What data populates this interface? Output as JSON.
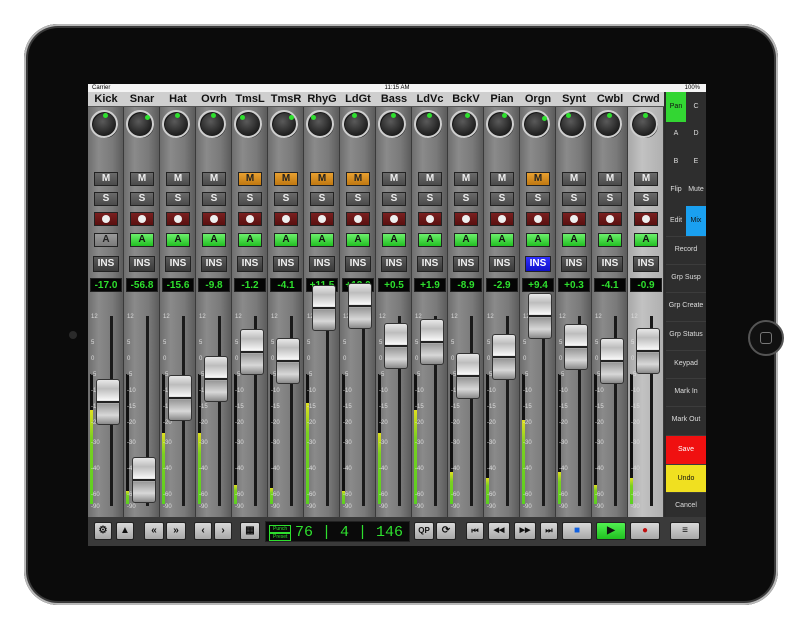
{
  "status_bar": {
    "carrier": "Carrier",
    "time": "11:15 AM",
    "battery": "100%"
  },
  "channels": [
    {
      "name": "Kick",
      "mute": "M",
      "mute_on": false,
      "solo": "S",
      "auto": "A",
      "auto_on": false,
      "ins": "INS",
      "ins_on": false,
      "level": "-17.0",
      "fader_db": -17.0,
      "meter": 0.72,
      "knob_angle": 0
    },
    {
      "name": "Snar",
      "mute": "M",
      "mute_on": false,
      "solo": "S",
      "auto": "A",
      "auto_on": true,
      "ins": "INS",
      "ins_on": false,
      "level": "-56.8",
      "fader_db": -56.8,
      "meter": 0.1,
      "knob_angle": 40
    },
    {
      "name": "Hat",
      "mute": "M",
      "mute_on": false,
      "solo": "S",
      "auto": "A",
      "auto_on": true,
      "ins": "INS",
      "ins_on": false,
      "level": "-15.6",
      "fader_db": -15.6,
      "meter": 0.55,
      "knob_angle": 0
    },
    {
      "name": "Ovrh",
      "mute": "M",
      "mute_on": false,
      "solo": "S",
      "auto": "A",
      "auto_on": true,
      "ins": "INS",
      "ins_on": false,
      "level": "-9.8",
      "fader_db": -9.8,
      "meter": 0.55,
      "knob_angle": 0
    },
    {
      "name": "TmsL",
      "mute": "M",
      "mute_on": true,
      "solo": "S",
      "auto": "A",
      "auto_on": true,
      "ins": "INS",
      "ins_on": false,
      "level": "-1.2",
      "fader_db": -1.2,
      "meter": 0.15,
      "knob_angle": -40
    },
    {
      "name": "TmsR",
      "mute": "M",
      "mute_on": true,
      "solo": "S",
      "auto": "A",
      "auto_on": true,
      "ins": "INS",
      "ins_on": false,
      "level": "-4.1",
      "fader_db": -4.1,
      "meter": 0.12,
      "knob_angle": 40
    },
    {
      "name": "RhyG",
      "mute": "M",
      "mute_on": true,
      "solo": "S",
      "auto": "A",
      "auto_on": true,
      "ins": "INS",
      "ins_on": false,
      "level": "+11.5",
      "fader_db": 11.5,
      "meter": 0.78,
      "knob_angle": -45
    },
    {
      "name": "LdGt",
      "mute": "M",
      "mute_on": true,
      "solo": "S",
      "auto": "A",
      "auto_on": true,
      "ins": "INS",
      "ins_on": false,
      "level": "+12.0",
      "fader_db": 12.0,
      "meter": 0.1,
      "knob_angle": -15
    },
    {
      "name": "Bass",
      "mute": "M",
      "mute_on": false,
      "solo": "S",
      "auto": "A",
      "auto_on": true,
      "ins": "INS",
      "ins_on": false,
      "level": "+0.5",
      "fader_db": 0.5,
      "meter": 0.55,
      "knob_angle": 0
    },
    {
      "name": "LdVc",
      "mute": "M",
      "mute_on": false,
      "solo": "S",
      "auto": "A",
      "auto_on": true,
      "ins": "INS",
      "ins_on": false,
      "level": "+1.9",
      "fader_db": 1.9,
      "meter": 0.72,
      "knob_angle": 0
    },
    {
      "name": "BckV",
      "mute": "M",
      "mute_on": false,
      "solo": "S",
      "auto": "A",
      "auto_on": true,
      "ins": "INS",
      "ins_on": false,
      "level": "-8.9",
      "fader_db": -8.9,
      "meter": 0.25,
      "knob_angle": 15
    },
    {
      "name": "Pian",
      "mute": "M",
      "mute_on": false,
      "solo": "S",
      "auto": "A",
      "auto_on": true,
      "ins": "INS",
      "ins_on": false,
      "level": "-2.9",
      "fader_db": -2.9,
      "meter": 0.2,
      "knob_angle": 20
    },
    {
      "name": "Orgn",
      "mute": "M",
      "mute_on": true,
      "solo": "S",
      "auto": "A",
      "auto_on": true,
      "ins": "INS",
      "ins_on": true,
      "level": "+9.4",
      "fader_db": 9.4,
      "meter": 0.65,
      "knob_angle": 50
    },
    {
      "name": "Synt",
      "mute": "M",
      "mute_on": false,
      "solo": "S",
      "auto": "A",
      "auto_on": true,
      "ins": "INS",
      "ins_on": false,
      "level": "+0.3",
      "fader_db": 0.3,
      "meter": 0.25,
      "knob_angle": -25
    },
    {
      "name": "Cwbl",
      "mute": "M",
      "mute_on": false,
      "solo": "S",
      "auto": "A",
      "auto_on": true,
      "ins": "INS",
      "ins_on": false,
      "level": "-4.1",
      "fader_db": -4.1,
      "meter": 0.15,
      "knob_angle": 0
    },
    {
      "name": "Crwd",
      "mute": "M",
      "mute_on": false,
      "solo": "S",
      "auto": "A",
      "auto_on": true,
      "ins": "INS",
      "ins_on": false,
      "level": "-0.9",
      "fader_db": -0.9,
      "meter": 0.2,
      "knob_angle": 0,
      "selected": true
    }
  ],
  "scale_labels": [
    "12",
    "5",
    "0",
    "-5",
    "-10",
    "-15",
    "-20",
    "-30",
    "-40",
    "-60",
    "-90"
  ],
  "side_panel": {
    "pan": "Pan",
    "c": "C",
    "a": "A",
    "d": "D",
    "b": "B",
    "e": "E",
    "flip": "Flip",
    "mute": "Mute",
    "edit": "Edit",
    "mix": "Mix",
    "record": "Record",
    "grp_susp": "Grp Susp",
    "grp_create": "Grp Create",
    "grp_status": "Grp Status",
    "keypad": "Keypad",
    "mark_in": "Mark In",
    "mark_out": "Mark Out",
    "save": "Save",
    "undo": "Undo",
    "cancel": "Cancel"
  },
  "transport": {
    "settings_icon": "gear-icon",
    "up_icon": "up-arrow-icon",
    "bank_left": "«",
    "bank_right": "»",
    "chan_left": "‹",
    "chan_right": "›",
    "grid_icon": "grid-icon",
    "punch_label": "Punch",
    "preset_label": "Preset",
    "counter": "76 | 4 | 146",
    "qp": "QP",
    "loop_icon": "loop-icon",
    "to_start": "⏮",
    "rewind": "◀◀",
    "fast_forward": "▶▶",
    "to_end": "⏭",
    "stop": "■",
    "play": "▶",
    "record": "●",
    "menu": "≡"
  }
}
